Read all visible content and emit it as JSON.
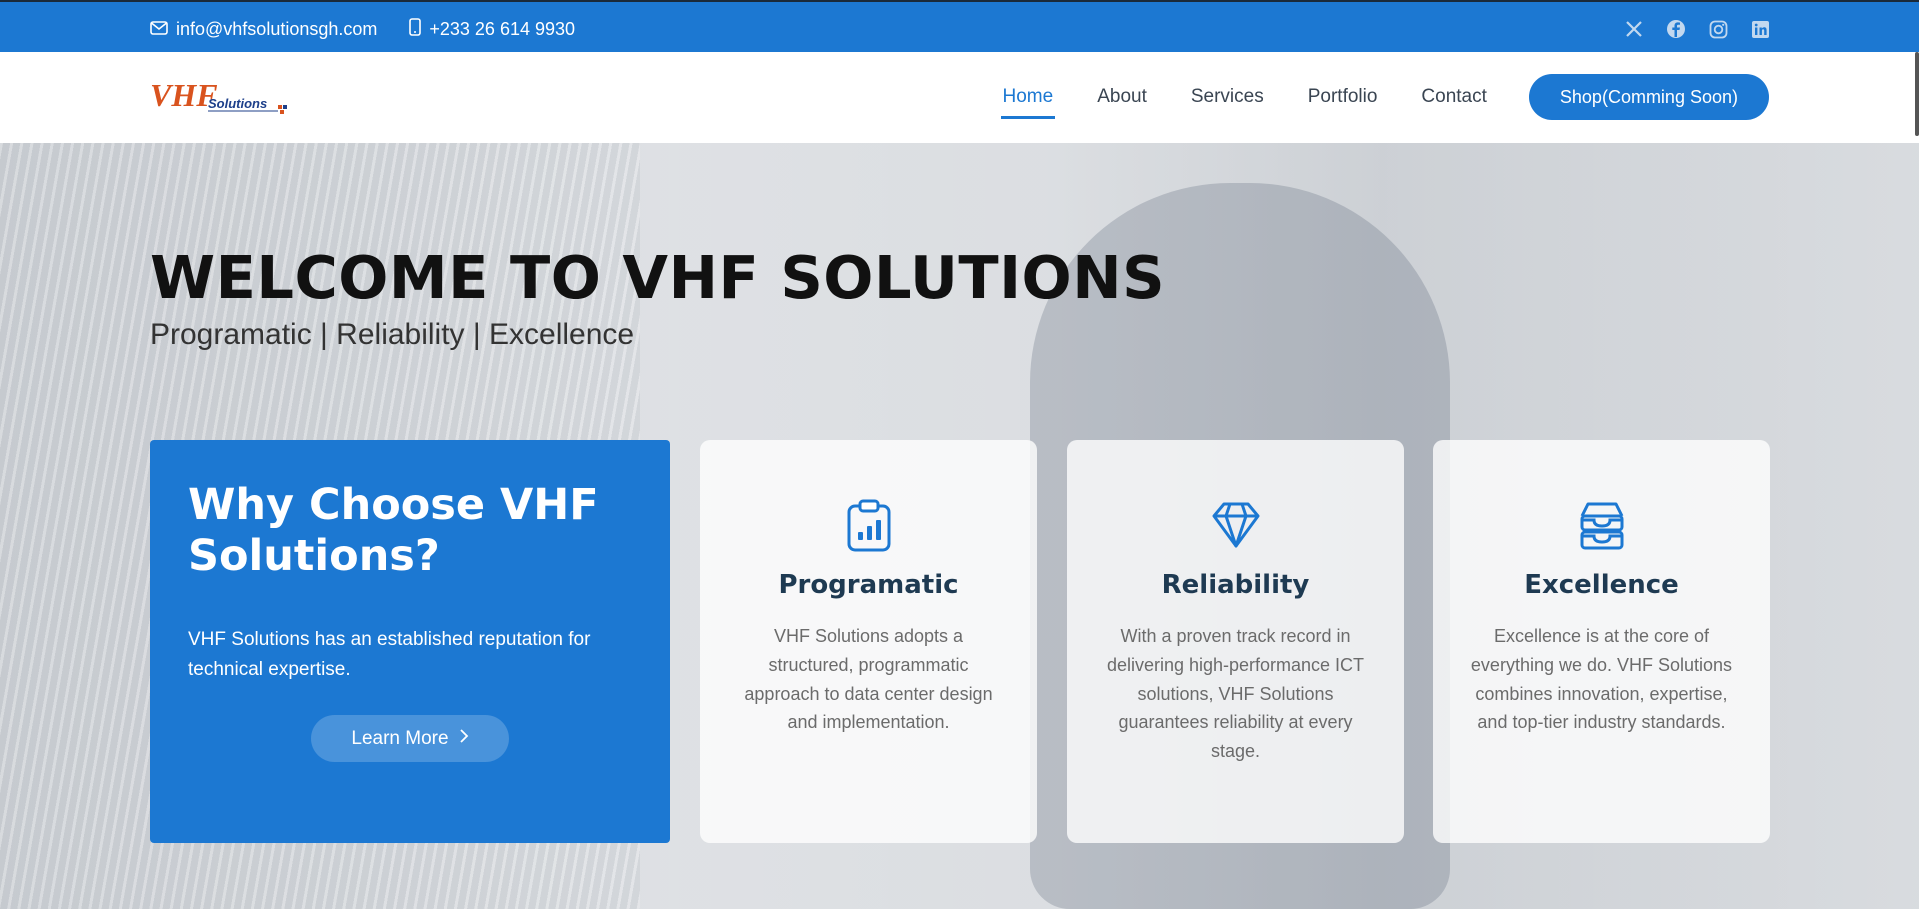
{
  "topbar": {
    "email": "info@vhfsolutionsgh.com",
    "phone": "+233 26 614 9930",
    "social": [
      "x-icon",
      "facebook-icon",
      "instagram-icon",
      "linkedin-icon"
    ]
  },
  "header": {
    "logo_text": "VHF Solutions",
    "nav": [
      {
        "label": "Home",
        "active": true
      },
      {
        "label": "About"
      },
      {
        "label": "Services"
      },
      {
        "label": "Portfolio"
      },
      {
        "label": "Contact"
      }
    ],
    "shop_label": "Shop(Comming Soon)"
  },
  "hero": {
    "title": "WELCOME TO VHF SOLUTIONS",
    "tagline": "Programatic | Reliability | Excellence"
  },
  "why": {
    "title": "Why Choose VHF Solutions?",
    "text": "VHF Solutions has an established reputation for technical expertise.",
    "button": "Learn More"
  },
  "cards": [
    {
      "icon": "clipboard-chart-icon",
      "title": "Programatic",
      "text": "VHF Solutions adopts a structured, programmatic approach to data center design and implementation."
    },
    {
      "icon": "diamond-icon",
      "title": "Reliability",
      "text": "With a proven track record in delivering high-performance ICT solutions, VHF Solutions guarantees reliability at every stage."
    },
    {
      "icon": "inbox-stack-icon",
      "title": "Excellence",
      "text": "Excellence is at the core of everything we do. VHF Solutions combines innovation, expertise, and top-tier industry standards."
    }
  ],
  "colors": {
    "primary": "#1c78d2",
    "heading": "#1e3a52"
  }
}
